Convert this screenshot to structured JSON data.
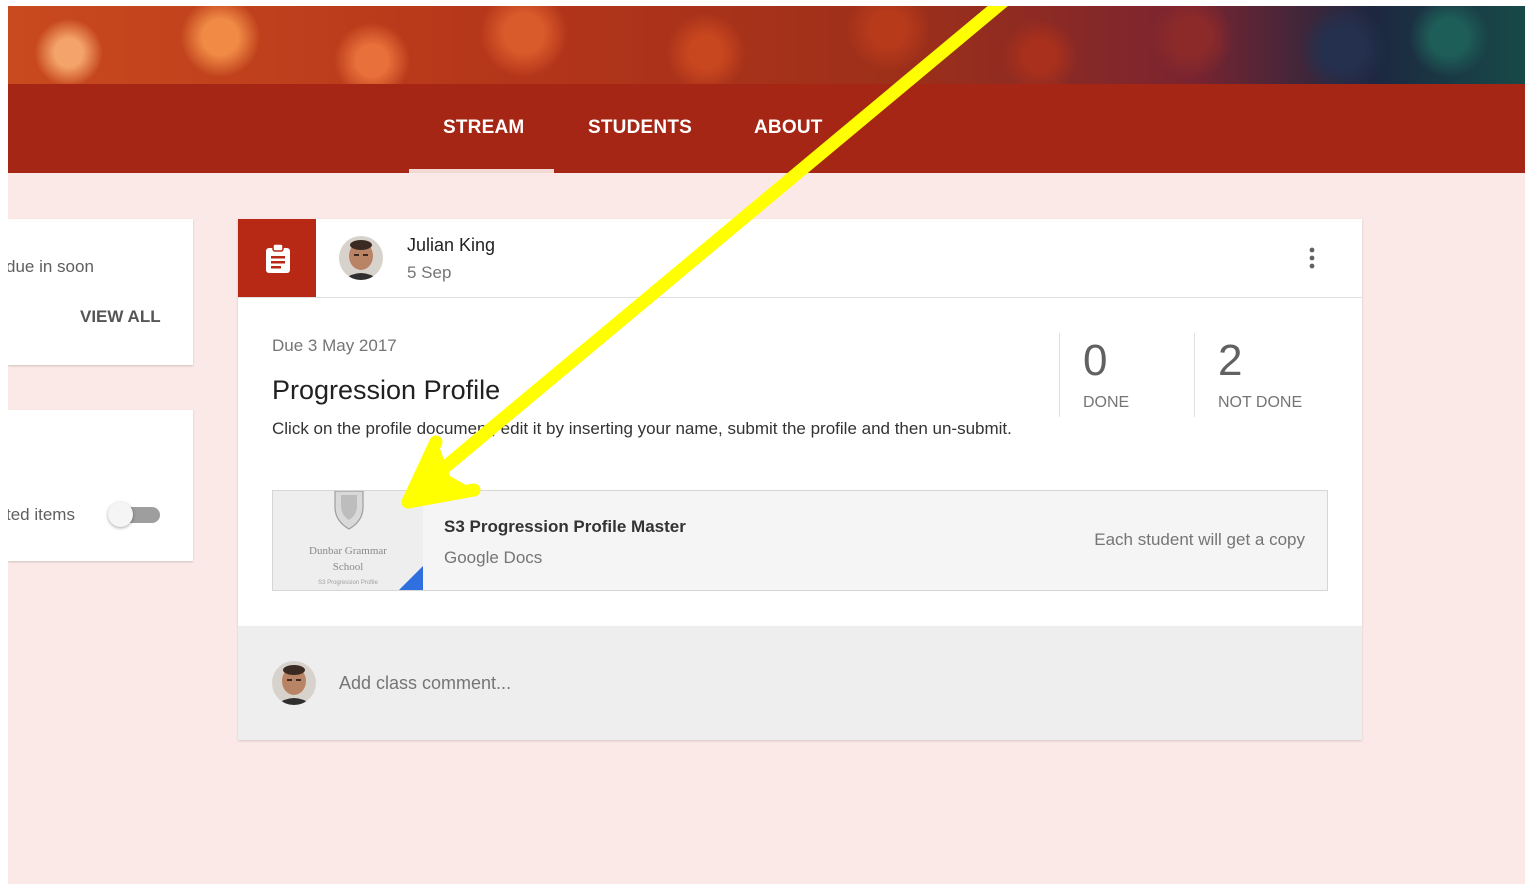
{
  "header": {
    "tabs": [
      {
        "label": "STREAM",
        "active": true
      },
      {
        "label": "STUDENTS",
        "active": false
      },
      {
        "label": "ABOUT",
        "active": false
      }
    ],
    "colors": {
      "header_bg": "#a62615",
      "page_bg": "#fbe9e7",
      "icon_box": "#b72815",
      "annotation_arrow": "#ffff00"
    }
  },
  "sidebar": {
    "upcoming_text": "due in soon",
    "view_all_label": "VIEW ALL",
    "toggle_label": "ted items",
    "toggle_on": false
  },
  "post": {
    "icon": "assignment-icon",
    "author": "Julian King",
    "date": "5 Sep",
    "due": "Due 3 May 2017",
    "title": "Progression Profile",
    "description": "Click on the profile document, edit it by inserting your name, submit the profile and then un-submit.",
    "stats": {
      "done_count": "0",
      "done_label": "DONE",
      "not_done_count": "2",
      "not_done_label": "NOT DONE"
    },
    "attachment": {
      "thumb_line1": "Dunbar Grammar",
      "thumb_line2": "School",
      "thumb_line3": "S3 Progression Profile",
      "name": "S3 Progression Profile Master",
      "type": "Google Docs",
      "copy_note": "Each student will get a copy"
    },
    "comment_placeholder": "Add class comment..."
  }
}
